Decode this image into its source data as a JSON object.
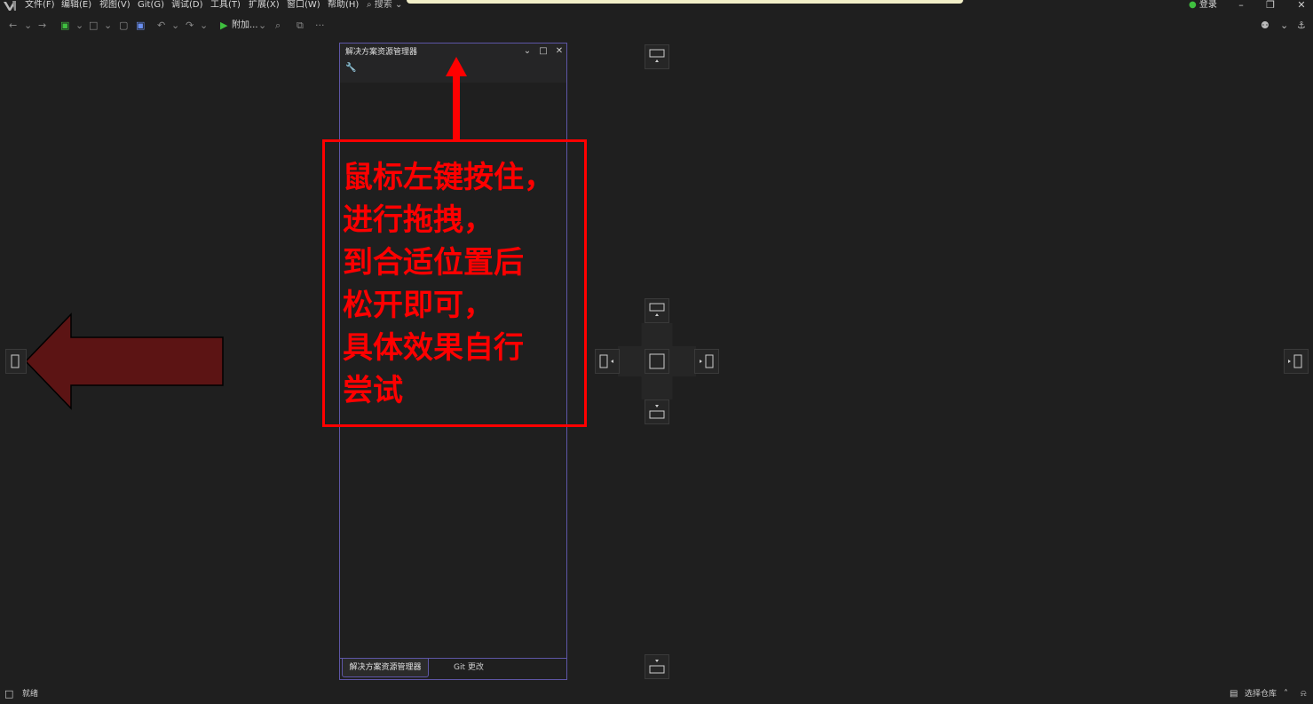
{
  "menubar": {
    "items": [
      "文件(F)",
      "编辑(E)",
      "视图(V)",
      "Git(G)",
      "调试(D)",
      "工具(T)",
      "扩展(X)",
      "窗口(W)",
      "帮助(H)"
    ],
    "search_label": "搜索",
    "login_label": "登录"
  },
  "toolbar": {
    "attach_label": "附加...",
    "more_label": "···"
  },
  "panel": {
    "title": "解决方案资源管理器",
    "tabs": [
      {
        "label": "解决方案资源管理器",
        "active": true
      },
      {
        "label": "Git 更改",
        "active": false
      }
    ]
  },
  "annotation": {
    "text": "鼠标左键按住，\n进行拖拽，\n到合适位置后\n松开即可，\n具体效果自行\n尝试"
  },
  "status": {
    "ready_text": "就绪",
    "repo_label": "选择仓库"
  },
  "colors": {
    "background": "#1f1f1f",
    "panel_border": "#5e56a6",
    "annotation_red": "#ff0000",
    "arrow_fill": "#5c1414",
    "play_green": "#3fbf3f"
  },
  "icons": [
    "vs-logo-icon",
    "search-icon",
    "account-icon",
    "minimize-icon",
    "restore-icon",
    "close-icon",
    "wrench-icon",
    "dock-guide-icon",
    "play-icon",
    "feedback-icon",
    "bell-icon"
  ]
}
